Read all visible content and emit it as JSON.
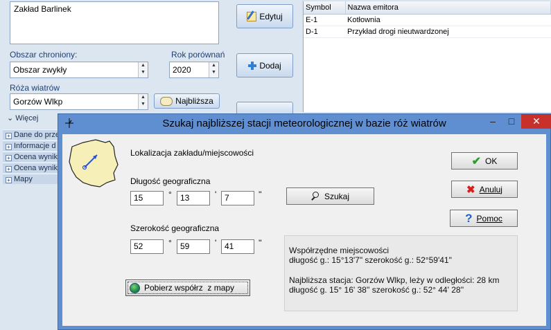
{
  "form": {
    "name_value": "Zakład Barlinek",
    "protected_area_label": "Obszar chroniony:",
    "protected_area_value": "Obszar zwykły",
    "year_label": "Rok porównań",
    "year_value": "2020",
    "windrose_label": "Róża wiatrów",
    "windrose_value": "Gorzów Wlkp",
    "nearest_button": "Najbliższa",
    "edit_button": "Edytuj",
    "add_button": "Dodaj",
    "more_label": "Więcej"
  },
  "tree": [
    "Dane do prze",
    "Informacje d",
    "Ocena wynik",
    "Ocena wynik",
    "Mapy"
  ],
  "grid": {
    "headers": [
      "Symbol",
      "Nazwa emitora"
    ],
    "rows": [
      [
        "E-1",
        "Kotłownia"
      ],
      [
        "D-1",
        "Przykład drogi nieutwardzonej"
      ]
    ]
  },
  "dialog": {
    "title": "Szukaj najbliższej stacji meteorologicznej w bazie róż wiatrów",
    "location_label": "Lokalizacja zakładu/miejscowości",
    "longitude_label": "Długość geograficzna",
    "lon_deg": "15",
    "lon_min": "13",
    "lon_sec": "7",
    "latitude_label": "Szerokość geograficzna",
    "lat_deg": "52",
    "lat_min": "59",
    "lat_sec": "41",
    "deg_sym": "°",
    "min_sym": "'",
    "sec_sym": "''",
    "search_button": "Szukaj",
    "ok_button": "OK",
    "cancel_button": "Anuluj",
    "help_button": "Pomoc",
    "map_button": "Pobierz współrz  z mapy",
    "info": {
      "line1": "Współrzędne miejscowości",
      "line2": "długość g.: 15°13'7\"    szerokość g.: 52°59'41\"",
      "line3": "Najbliższa stacja: Gorzów Wlkp, leży w odległości: 28 km",
      "line4": "długość g. 15° 16' 38''  szerokość g.: 52° 44' 28''"
    },
    "minimize": "–",
    "maximize": "□",
    "close": "✕"
  }
}
